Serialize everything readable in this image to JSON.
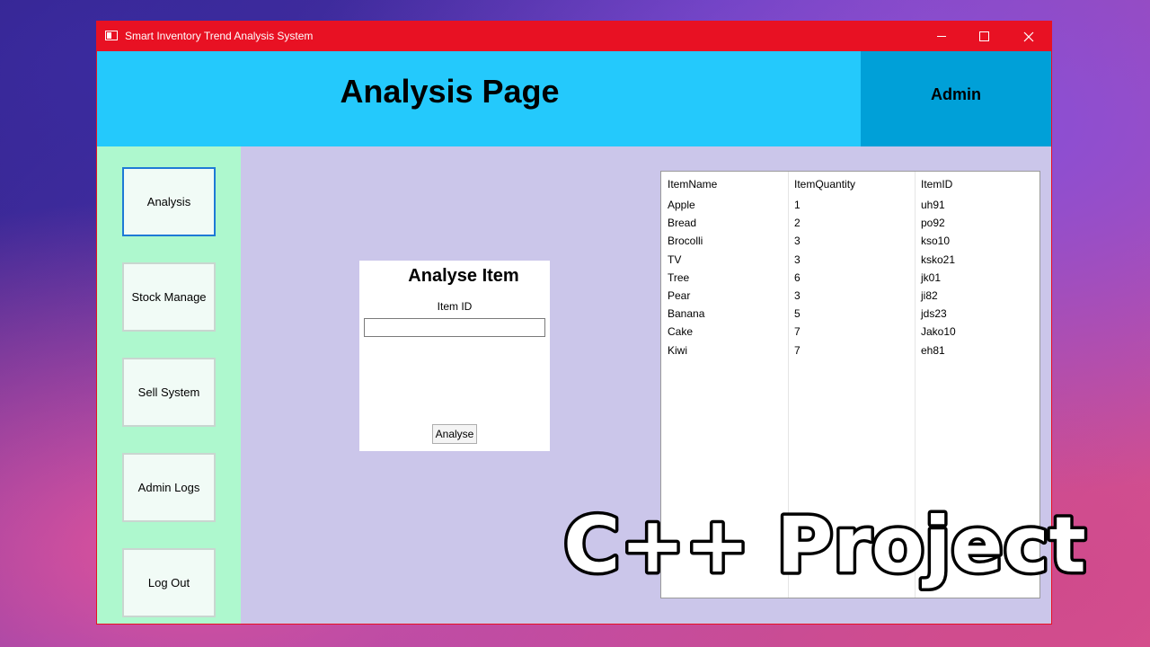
{
  "window": {
    "title": "Smart Inventory Trend Analysis System"
  },
  "titlebar_controls": {
    "minimize": "minimize-icon",
    "maximize": "maximize-icon",
    "close": "close-icon"
  },
  "header": {
    "title": "Analysis Page",
    "user": "Admin"
  },
  "sidebar": {
    "items": [
      {
        "label": "Analysis",
        "active": true
      },
      {
        "label": "Stock Manage"
      },
      {
        "label": "Sell System"
      },
      {
        "label": "Admin Logs"
      },
      {
        "label": "Log Out"
      }
    ]
  },
  "analyse": {
    "title": "Analyse Item",
    "field_label": "Item ID",
    "input_value": "",
    "button": "Analyse"
  },
  "table": {
    "columns": [
      "ItemName",
      "ItemQuantity",
      "ItemID"
    ],
    "rows": [
      [
        "Apple",
        "1",
        "uh91"
      ],
      [
        "Bread",
        "2",
        "po92"
      ],
      [
        "Brocolli",
        "3",
        "kso10"
      ],
      [
        "TV",
        "3",
        "ksko21"
      ],
      [
        "Tree",
        "6",
        "jk01"
      ],
      [
        "Pear",
        "3",
        "ji82"
      ],
      [
        "Banana",
        "5",
        "jds23"
      ],
      [
        "Cake",
        "7",
        "Jako10"
      ],
      [
        "Kiwi",
        "7",
        "eh81"
      ]
    ]
  },
  "overlay": {
    "text": "C++ Project"
  },
  "colors": {
    "titlebar": "#e81123",
    "header": "#24c9fc",
    "user_panel": "#00a0d8",
    "sidebar": "#aef8ce",
    "content": "#cbc6ea",
    "active_border": "#1e7ad6"
  }
}
